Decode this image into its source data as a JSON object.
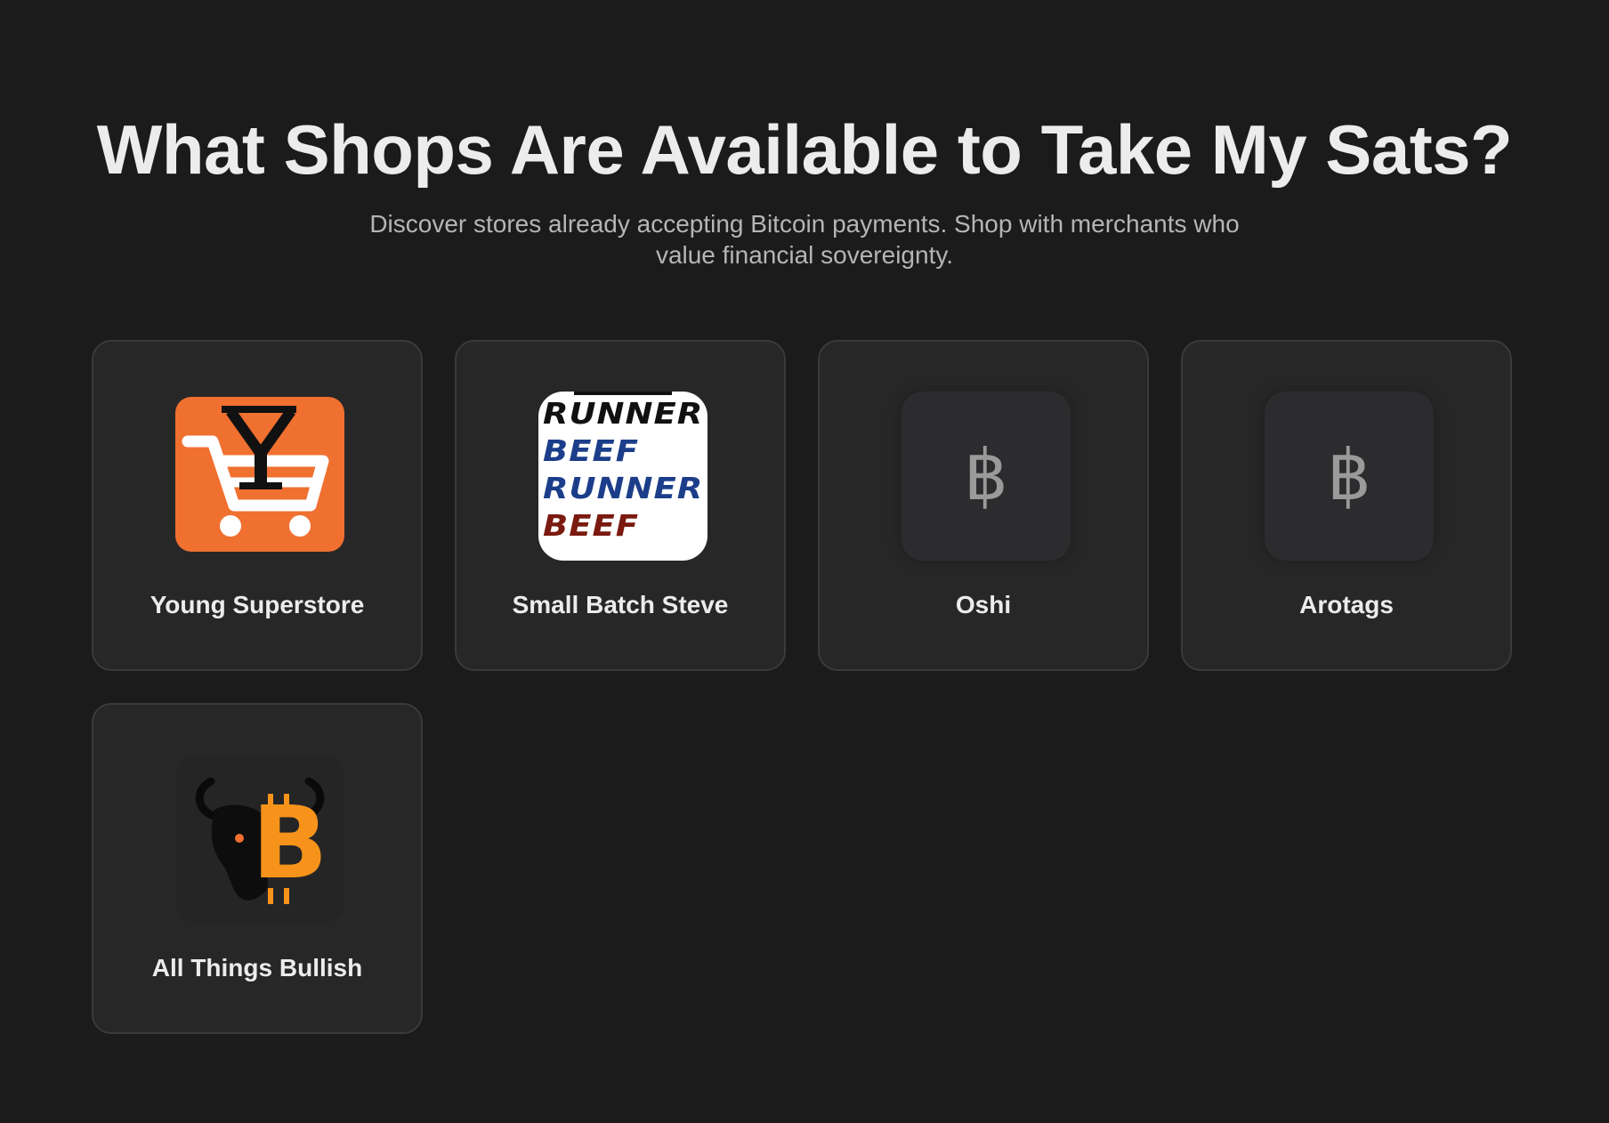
{
  "header": {
    "title": "What Shops Are Available to Take My Sats?",
    "subtitle": "Discover stores already accepting Bitcoin payments. Shop with merchants who value financial sovereignty."
  },
  "shops": [
    {
      "name": "Young Superstore",
      "logo": "shopping-cart-y-logo",
      "logo_color": "#f07030"
    },
    {
      "name": "Small Batch Steve",
      "logo": "beef-runner-logo",
      "logo_lines": [
        "RUNNER",
        "BEEF",
        "RUNNER",
        "BEEF"
      ]
    },
    {
      "name": "Oshi",
      "logo": "bitcoin-icon",
      "logo_glyph": "฿"
    },
    {
      "name": "Arotags",
      "logo": "bitcoin-icon",
      "logo_glyph": "฿"
    },
    {
      "name": "All Things Bullish",
      "logo": "bull-bitcoin-logo",
      "logo_glyph": "B",
      "logo_color": "#f7931a"
    }
  ],
  "colors": {
    "background": "#1b1b1c",
    "card": "#272728",
    "card_border": "#3a3a3c",
    "accent_orange": "#f07030",
    "beef_blue": "#1c3e8a",
    "beef_red": "#7a1a10"
  }
}
